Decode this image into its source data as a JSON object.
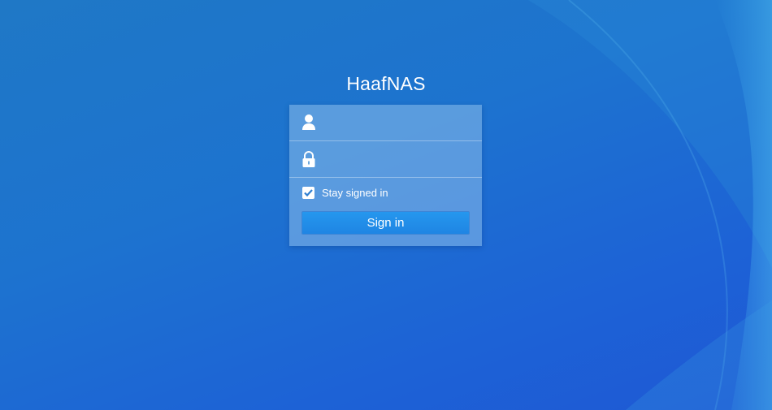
{
  "app": {
    "title": "HaafNAS"
  },
  "login": {
    "username": {
      "value": "",
      "placeholder": "",
      "icon": "user-icon"
    },
    "password": {
      "value": "",
      "placeholder": "",
      "icon": "lock-icon"
    },
    "stay_signed_in": {
      "label": "Stay signed in",
      "checked": true
    },
    "signin_label": "Sign in"
  },
  "colors": {
    "background": "#1d6fd0",
    "button": "#1f8ae6",
    "panel": "#8cbeeb",
    "text": "#ffffff"
  }
}
